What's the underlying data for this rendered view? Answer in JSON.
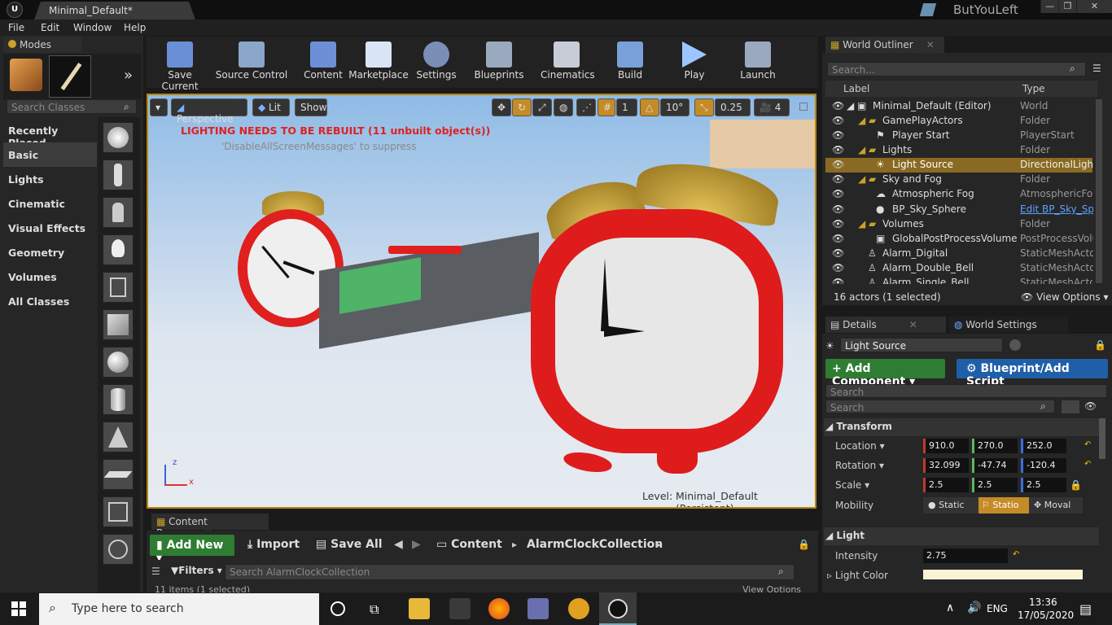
{
  "window": {
    "tab_title": "Minimal_Default*",
    "user": "ButYouLeft",
    "controls": [
      "—",
      "❐",
      "✕"
    ]
  },
  "menu": [
    "File",
    "Edit",
    "Window",
    "Help"
  ],
  "modes": {
    "tab": "Modes",
    "search_placeholder": "Search Classes",
    "categories": [
      "Recently Placed",
      "Basic",
      "Lights",
      "Cinematic",
      "Visual Effects",
      "Geometry",
      "Volumes",
      "All Classes"
    ],
    "selected_category": "Basic"
  },
  "toolbar": {
    "buttons": [
      "Save Current",
      "Source Control",
      "Content",
      "Marketplace",
      "Settings",
      "Blueprints",
      "Cinematics",
      "Build",
      "Play",
      "Launch"
    ]
  },
  "viewport": {
    "perspective": "Perspective",
    "lit": "Lit",
    "show": "Show",
    "grid_snap": "1",
    "angle_snap": "10°",
    "scale_snap": "0.25",
    "camera_speed": "4",
    "warning": "LIGHTING NEEDS TO BE REBUILT (11 unbuilt object(s))",
    "warning_hint": "'DisableAllScreenMessages' to suppress",
    "level_label": "Level:",
    "level_name": "Minimal_Default (Persistent)",
    "axis_x": "x",
    "axis_z": "z"
  },
  "content_browser": {
    "tab": "Content Browser",
    "add_new": "Add New",
    "import": "Import",
    "save_all": "Save All",
    "path": [
      "Content",
      "AlarmClockCollection"
    ],
    "filters": "Filters",
    "search_placeholder": "Search AlarmClockCollection",
    "items_count": "11 items (1 selected)",
    "view_options": "View Options"
  },
  "outliner": {
    "tab": "World Outliner",
    "search_placeholder": "Search...",
    "col_label": "Label",
    "col_type": "Type",
    "rows": [
      {
        "label": "Minimal_Default (Editor)",
        "type": "World"
      },
      {
        "label": "GamePlayActors",
        "type": "Folder"
      },
      {
        "label": "Player Start",
        "type": "PlayerStart"
      },
      {
        "label": "Lights",
        "type": "Folder"
      },
      {
        "label": "Light Source",
        "type": "DirectionalLight"
      },
      {
        "label": "Sky and Fog",
        "type": "Folder"
      },
      {
        "label": "Atmospheric Fog",
        "type": "AtmosphericFog"
      },
      {
        "label": "BP_Sky_Sphere",
        "type": "Edit BP_Sky_Sp"
      },
      {
        "label": "Volumes",
        "type": "Folder"
      },
      {
        "label": "GlobalPostProcessVolume",
        "type": "PostProcessVolu"
      },
      {
        "label": "Alarm_Digital",
        "type": "StaticMeshActor"
      },
      {
        "label": "Alarm_Double_Bell",
        "type": "StaticMeshActor"
      },
      {
        "label": "Alarm_Single_Bell",
        "type": "StaticMeshActor"
      }
    ],
    "footer": "16 actors (1 selected)",
    "view_options": "View Options"
  },
  "details": {
    "tab_details": "Details",
    "tab_world": "World Settings",
    "name": "Light Source",
    "add_component": "Add Component",
    "blueprint": "Blueprint/Add Script",
    "search1": "Search",
    "search2": "Search",
    "transform": "Transform",
    "location_label": "Location",
    "location": [
      "910.0",
      "270.0",
      "252.0"
    ],
    "rotation_label": "Rotation",
    "rotation": [
      "32.099",
      "-47.74",
      "-120.4"
    ],
    "scale_label": "Scale",
    "scale": [
      "2.5",
      "2.5",
      "2.5"
    ],
    "mobility_label": "Mobility",
    "mobility": [
      "Static",
      "Statio",
      "Moval"
    ],
    "light": "Light",
    "intensity_label": "Intensity",
    "intensity": "2.75",
    "light_color_label": "Light Color",
    "light_color": "#fbf3d6"
  },
  "taskbar": {
    "search": "Type here to search",
    "lang": "ENG",
    "time": "13:36",
    "date": "17/05/2020"
  }
}
